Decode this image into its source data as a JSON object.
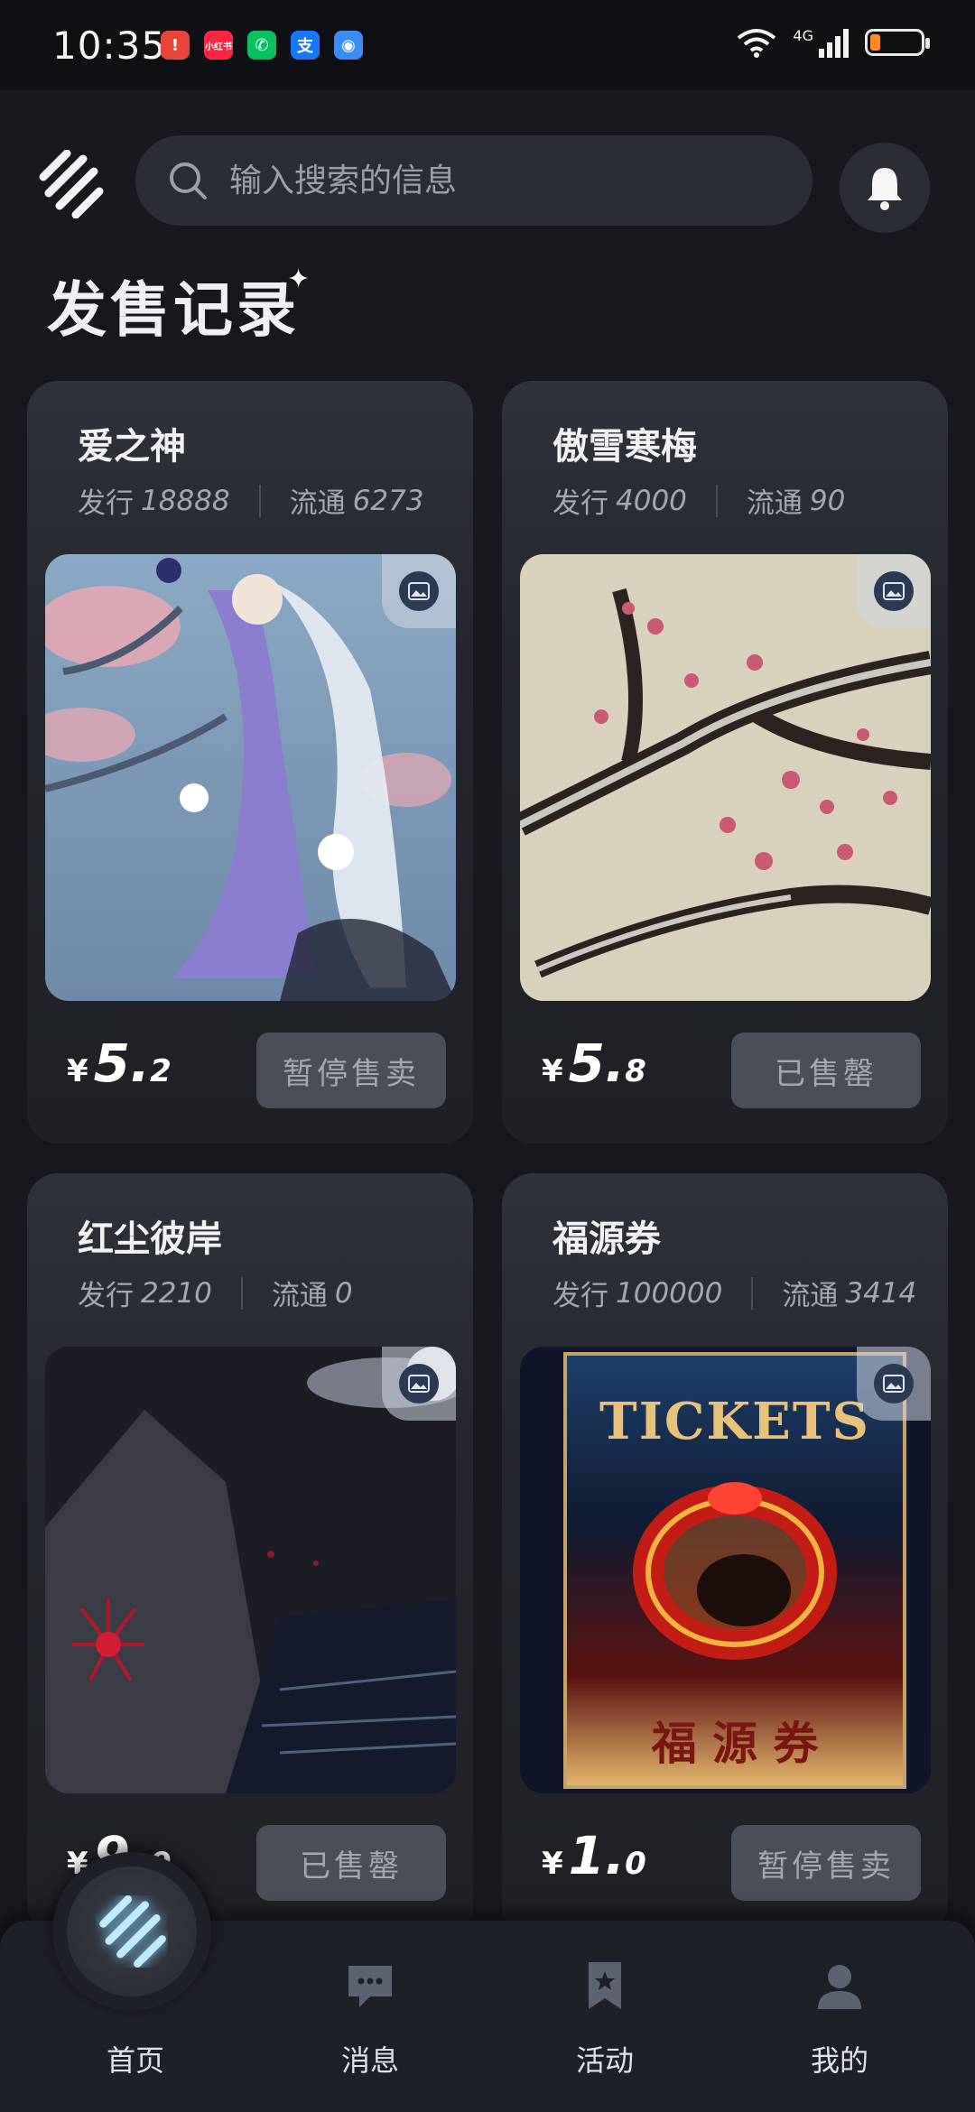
{
  "status_bar": {
    "time": "10:35",
    "network": "4G",
    "app_icons": [
      {
        "name": "notification-app-icon",
        "label": "!",
        "color": "#e8443a"
      },
      {
        "name": "xiaohongshu-app-icon",
        "label": "小红书",
        "color": "#ff2442"
      },
      {
        "name": "wechat-app-icon",
        "label": "✆",
        "color": "#07c160"
      },
      {
        "name": "alipay-app-icon",
        "label": "支",
        "color": "#1677ff"
      },
      {
        "name": "browser-app-icon",
        "label": "◉",
        "color": "#3a8df5"
      }
    ],
    "battery_color": "#ff8a1f"
  },
  "header": {
    "search_placeholder": "输入搜索的信息",
    "page_title": "发售记录"
  },
  "labels": {
    "issue": "发行",
    "circulation": "流通",
    "currency": "¥"
  },
  "cards": [
    {
      "title": "爱之神",
      "issue": "18888",
      "circulation": "6273",
      "price_int": "5.",
      "price_dec": "2",
      "status": "暂停售卖"
    },
    {
      "title": "傲雪寒梅",
      "issue": "4000",
      "circulation": "90",
      "price_int": "5.",
      "price_dec": "8",
      "status": "已售罄"
    },
    {
      "title": "红尘彼岸",
      "issue": "2210",
      "circulation": "0",
      "price_int": "9.",
      "price_dec": "9",
      "status": "已售罄"
    },
    {
      "title": "福源券",
      "issue": "100000",
      "circulation": "3414",
      "price_int": "1.",
      "price_dec": "0",
      "status": "暂停售卖"
    }
  ],
  "ticket_art": {
    "heading": "TICKETS",
    "caption": "福 源 券"
  },
  "bottom_nav": [
    {
      "label": "首页",
      "icon": "home-logo-icon"
    },
    {
      "label": "消息",
      "icon": "message-icon"
    },
    {
      "label": "活动",
      "icon": "activity-bookmark-icon"
    },
    {
      "label": "我的",
      "icon": "profile-icon"
    }
  ],
  "colors": {
    "background": "#16181d",
    "card": "#2a2d33",
    "status_button": "#4a4e56",
    "accent_glow": "#7fd6ff"
  }
}
